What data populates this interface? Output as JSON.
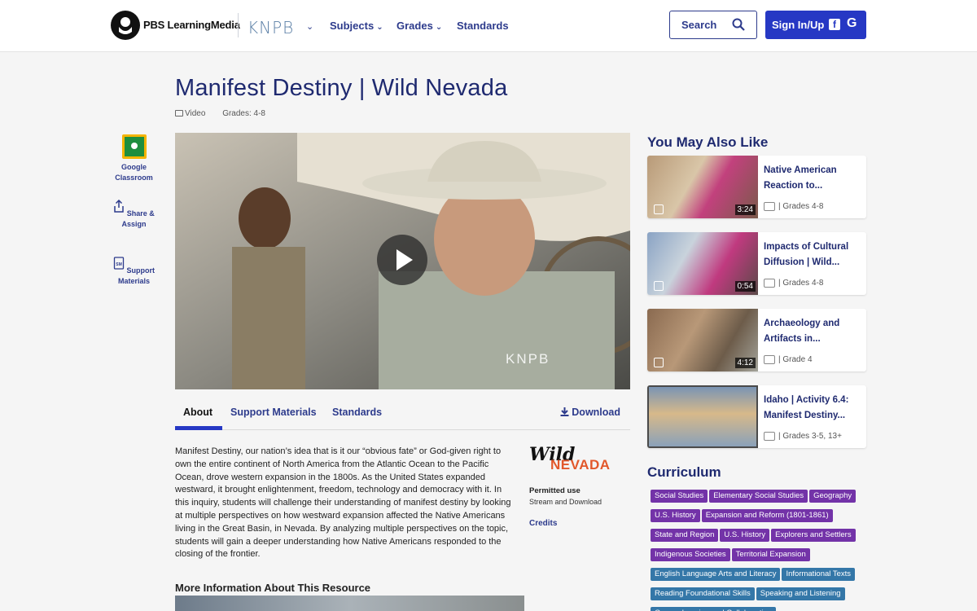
{
  "header": {
    "brand": "PBS LearningMedia",
    "station": "KNPB",
    "nav": [
      {
        "label": "Subjects"
      },
      {
        "label": "Grades"
      },
      {
        "label": "Standards"
      }
    ],
    "search_label": "Search",
    "signin_label": "Sign In/Up"
  },
  "resource": {
    "title": "Manifest Destiny | Wild Nevada",
    "type": "Video",
    "grades": "Grades: 4-8",
    "video_watermark": "KNPB"
  },
  "rail": [
    {
      "label": "Google Classroom"
    },
    {
      "label": "Share & Assign"
    },
    {
      "label": "Support Materials"
    }
  ],
  "tabs": {
    "items": [
      "About",
      "Support Materials",
      "Standards"
    ],
    "active": "About",
    "download": "Download"
  },
  "description": "Manifest Destiny, our nation’s idea that is it our “obvious fate” or God-given right to own the entire continent of North America from the Atlantic Ocean to the Pacific Ocean, drove western expansion in the 1800s. As the United States expanded westward, it brought enlightenment, freedom, technology and democracy with it. In this inquiry, students will challenge their understanding of manifest destiny by looking at multiple perspectives on how westward expansion affected the Native Americans living in the Great Basin, in Nevada. By analyzing multiple perspectives on the topic, students will gain a deeper understanding how Native Americans responded to the closing of the frontier.",
  "more_info_heading": "More Information About This Resource",
  "side": {
    "brand_top": "Wild",
    "brand_bottom": "NEVADA",
    "permitted_label": "Permitted use",
    "permitted_value": "Stream and Download",
    "credits": "Credits"
  },
  "related": {
    "heading": "You May Also Like",
    "items": [
      {
        "title": "Native American Reaction to...",
        "duration": "3:24",
        "grades": "| Grades 4-8"
      },
      {
        "title": "Impacts of Cultural Diffusion | Wild...",
        "duration": "0:54",
        "grades": "| Grades 4-8"
      },
      {
        "title": "Archaeology and Artifacts in...",
        "duration": "4:12",
        "grades": "| Grade 4"
      },
      {
        "title": "Idaho | Activity 6.4: Manifest Destiny...",
        "duration": "",
        "grades": "| Grades 3-5, 13+"
      }
    ]
  },
  "curriculum": {
    "heading": "Curriculum",
    "tags_purple": [
      "Social Studies",
      "Elementary Social Studies",
      "Geography",
      "U.S. History",
      "Expansion and Reform (1801-1861)",
      "State and Region",
      "U.S. History",
      "Explorers and Settlers",
      "Indigenous Societies",
      "Territorial Expansion"
    ],
    "tags_teal": [
      "English Language Arts and Literacy",
      "Informational Texts",
      "Reading Foundational Skills",
      "Speaking and Listening",
      "Comprehension and Collaboration"
    ]
  },
  "colors": {
    "primary": "#2638c4",
    "heading": "#1f2a70",
    "tag_purple": "#7333a8",
    "tag_teal": "#3477a8"
  }
}
